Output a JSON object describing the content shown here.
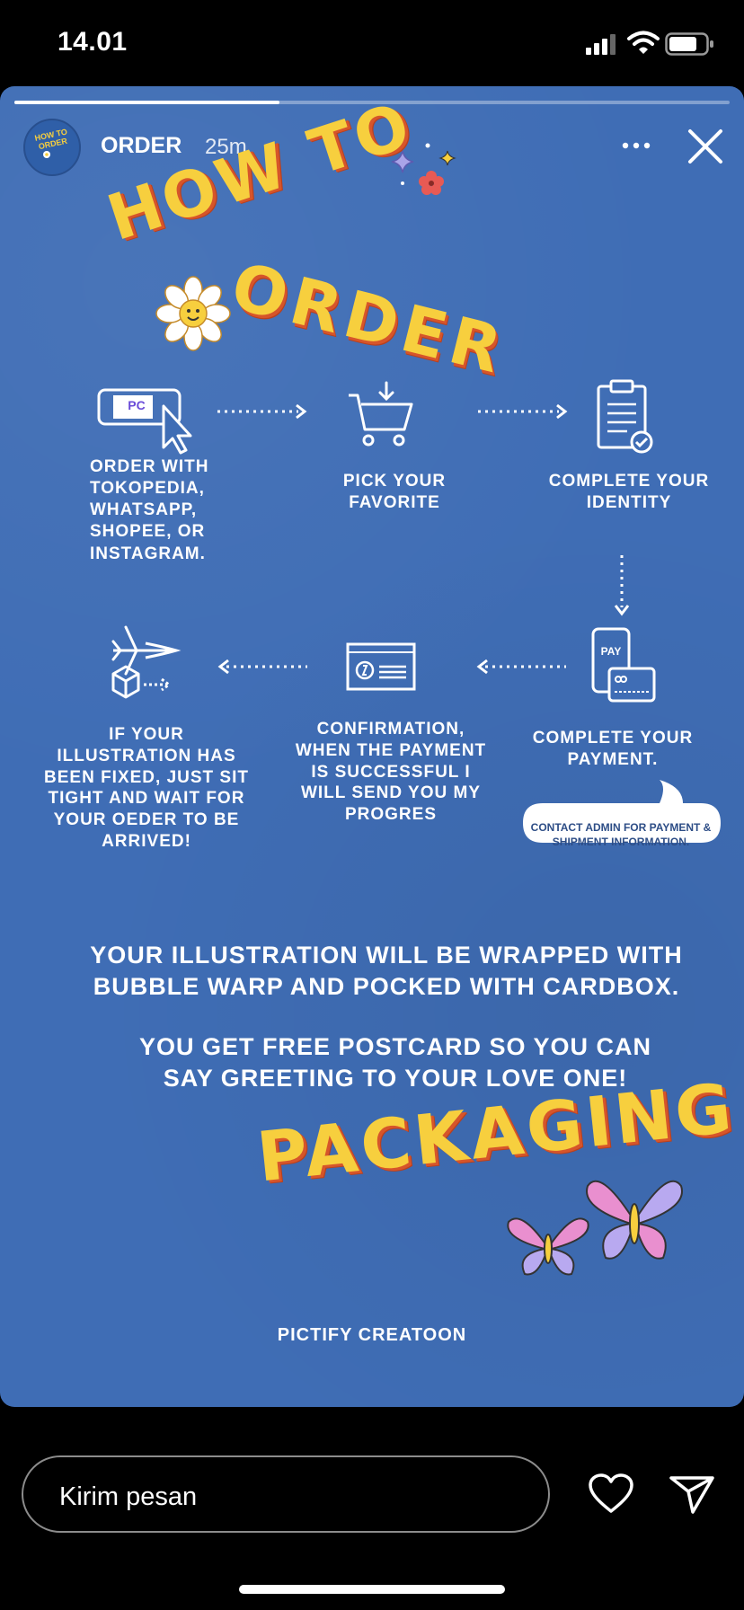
{
  "status_bar": {
    "time": "14.01"
  },
  "story": {
    "username": "ORDER",
    "age": "25m",
    "progress": 0.37,
    "avatar_text": "HOW TO ORDER",
    "title_how_to": "HOW TO",
    "title_order": "ORDER",
    "mini_logo": "PC",
    "steps": [
      {
        "label": "ORDER WITH TOKOPEDIA, WHATSAPP, SHOPEE, OR INSTAGRAM."
      },
      {
        "label": "PICK YOUR FAVORITE"
      },
      {
        "label": "COMPLETE YOUR IDENTITY"
      },
      {
        "label": "COMPLETE YOUR PAYMENT."
      },
      {
        "label": "CONFIRMATION, WHEN THE PAYMENT IS SUCCESSFUL I WILL SEND YOU MY PROGRES"
      },
      {
        "label": "IF YOUR ILLUSTRATION HAS BEEN FIXED, JUST SIT TIGHT AND WAIT FOR YOUR OEDER TO BE ARRIVED!"
      }
    ],
    "pay_label": "PAY",
    "contact_bubble": "CONTACT ADMIN FOR PAYMENT & SHIPMENT INFORMATION.",
    "wrap_text": "YOUR ILLUSTRATION WILL BE WRAPPED WITH BUBBLE WARP AND POCKED WITH CARDBOX.",
    "postcard_text": "YOU GET FREE POSTCARD SO YOU CAN SAY GREETING TO YOUR LOVE ONE!",
    "packaging_title": "PACKAGING",
    "brand": "PICTIFY CREATOON"
  },
  "reply": {
    "placeholder": "Kirim pesan"
  },
  "icons": {
    "more": "more-icon",
    "close": "close-icon",
    "heart": "heart-icon",
    "send": "send-icon"
  },
  "colors": {
    "background": "#3f6db5",
    "title_yellow": "#f7cf3e",
    "title_shadow": "#d6552a"
  }
}
